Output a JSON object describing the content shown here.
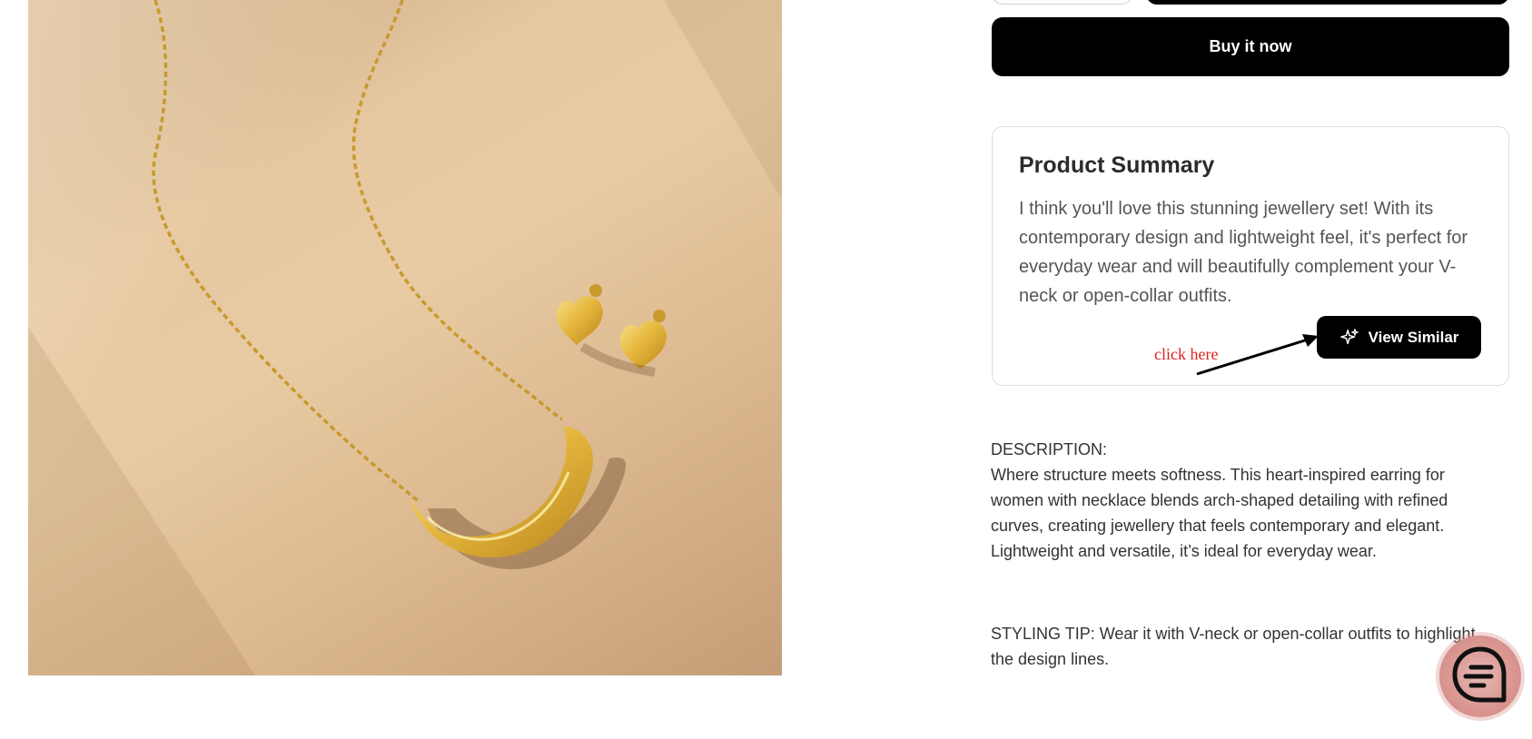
{
  "actions": {
    "buy_now_label": "Buy it now"
  },
  "summary": {
    "title": "Product Summary",
    "text": "I think you'll love this stunning jewellery set! With its contemporary design and lightweight feel, it's perfect for everyday wear and will beautifully complement your V-neck or open-collar outfits.",
    "view_similar_label": "View Similar",
    "annotation": "click here"
  },
  "description": {
    "heading": "DESCRIPTION:",
    "body": "Where structure meets softness. This heart-inspired earring for women with necklace blends arch-shaped detailing with refined curves, creating jewellery that feels contemporary and elegant. Lightweight and versatile, it’s ideal for everyday wear."
  },
  "styling_tip": {
    "text": "STYLING TIP: Wear it with V-neck or open-collar outfits to highlight the design lines."
  },
  "icons": {
    "view_similar": "sparkle-icon",
    "chat": "chat-icon"
  },
  "colors": {
    "primary_button": "#000000",
    "annotation": "#e02020",
    "chat_fab": "#d99590"
  }
}
